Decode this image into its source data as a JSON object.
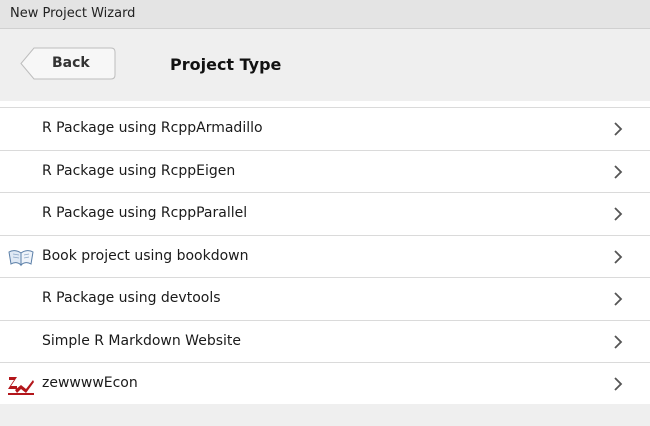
{
  "window": {
    "title": "New Project Wizard"
  },
  "header": {
    "back_label": "Back",
    "page_title": "Project Type"
  },
  "project_types": [
    {
      "label": "R Package using RcppArmadillo",
      "icon": ""
    },
    {
      "label": "R Package using RcppEigen",
      "icon": ""
    },
    {
      "label": "R Package using RcppParallel",
      "icon": ""
    },
    {
      "label": "Book project using bookdown",
      "icon": "open-book-icon"
    },
    {
      "label": "R Package using devtools",
      "icon": ""
    },
    {
      "label": "Simple R Markdown Website",
      "icon": ""
    },
    {
      "label": "zewwwwEcon",
      "icon": "zew-logo-icon"
    }
  ],
  "colors": {
    "zew_logo": "#b3161b",
    "chevron": "#555555"
  }
}
